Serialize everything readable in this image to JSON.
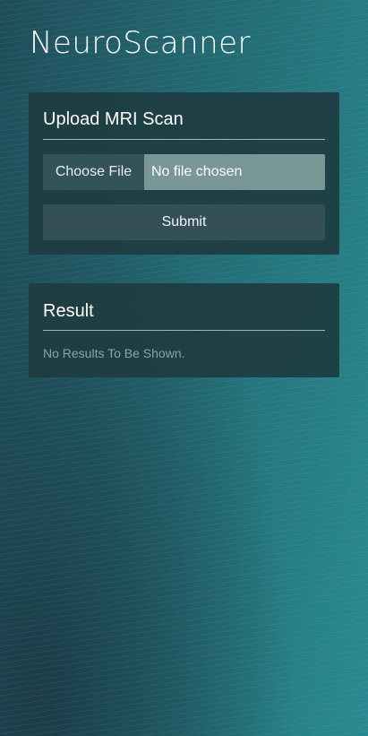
{
  "app": {
    "title": "NeuroScanner"
  },
  "upload": {
    "heading": "Upload MRI Scan",
    "choose_file_label": "Choose File",
    "file_status": "No file chosen",
    "submit_label": "Submit"
  },
  "result": {
    "heading": "Result",
    "message": "No Results To Be Shown."
  }
}
